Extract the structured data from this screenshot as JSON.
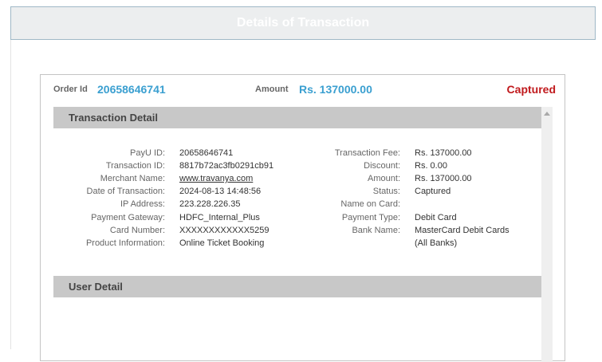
{
  "header": {
    "title": "Details of Transaction"
  },
  "summary": {
    "order_id_label": "Order Id",
    "order_id_value": "20658646741",
    "amount_label": "Amount",
    "amount_value": "Rs. 137000.00",
    "status": "Captured"
  },
  "sections": {
    "transaction_detail": "Transaction Detail",
    "user_detail": "User Detail"
  },
  "details_left": [
    {
      "label": "PayU ID:",
      "value": "20658646741"
    },
    {
      "label": "Transaction ID:",
      "value": "8817b72ac3fb0291cb91"
    },
    {
      "label": "Merchant Name:",
      "value": "www.travanya.com"
    },
    {
      "label": "Date of Transaction:",
      "value": "2024-08-13 14:48:56"
    },
    {
      "label": "IP Address:",
      "value": "223.228.226.35"
    },
    {
      "label": "Payment Gateway:",
      "value": "HDFC_Internal_Plus"
    },
    {
      "label": "Card Number:",
      "value": "XXXXXXXXXXXX5259"
    },
    {
      "label": "Product Information:",
      "value": "Online Ticket Booking"
    }
  ],
  "details_right": [
    {
      "label": "Transaction Fee:",
      "value": "Rs. 137000.00"
    },
    {
      "label": "Discount:",
      "value": "Rs. 0.00"
    },
    {
      "label": "Amount:",
      "value": "Rs. 137000.00"
    },
    {
      "label": "Status:",
      "value": "Captured"
    },
    {
      "label": "Name on Card:",
      "value": ""
    },
    {
      "label": "Payment Type:",
      "value": "Debit Card"
    },
    {
      "label": "Bank Name:",
      "value": "MasterCard Debit Cards"
    },
    {
      "label": "",
      "value": "(All Banks)"
    }
  ],
  "colors": {
    "accent_blue": "#3a9fd0",
    "status_red": "#c0191c",
    "section_gray": "#c8c8c8"
  }
}
